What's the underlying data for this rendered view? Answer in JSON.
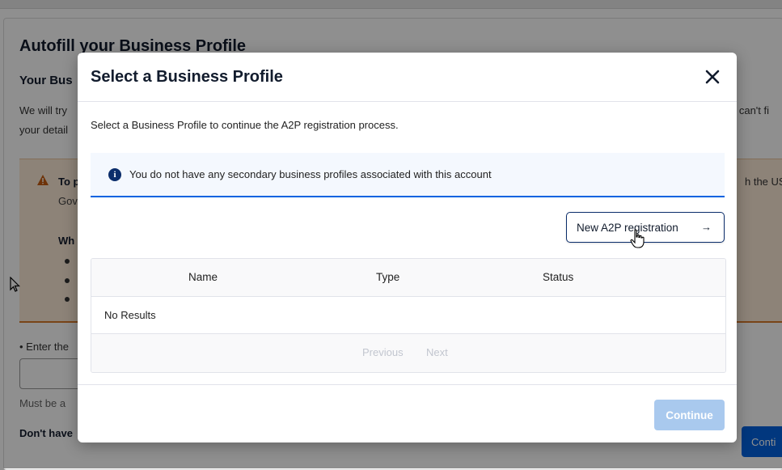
{
  "background": {
    "title": "Autofill your Business Profile",
    "subtitle": "Your Bus",
    "description_line1": "We will try",
    "description_line2": "your detail",
    "description_right": "h can't fi",
    "warning_title": "To p",
    "warning_line2": "Gov",
    "warning_right": "h the US",
    "warning_what": "Wh",
    "enter_label": "• Enter the",
    "must_be": "Must be a",
    "dont_have": "Don't have",
    "continue_label": "Conti"
  },
  "modal": {
    "title": "Select a Business Profile",
    "intro": "Select a Business Profile to continue the A2P registration process.",
    "info_banner": "You do not have any secondary business profiles associated with this account",
    "new_registration_label": "New A2P registration",
    "new_registration_arrow": "→",
    "table": {
      "columns": [
        "Name",
        "Type",
        "Status"
      ],
      "empty_text": "No Results"
    },
    "pagination": {
      "previous": "Previous",
      "next": "Next"
    },
    "continue_label": "Continue"
  },
  "colors": {
    "primary": "#0263e0",
    "navy": "#0b2d6b",
    "continue_disabled": "#a9c9ee",
    "warning_bg": "#fcead6"
  },
  "icons": [
    "close-icon",
    "info-icon",
    "arrow-right-icon",
    "warning-icon",
    "hand-pointer-icon",
    "arrow-cursor-icon"
  ]
}
